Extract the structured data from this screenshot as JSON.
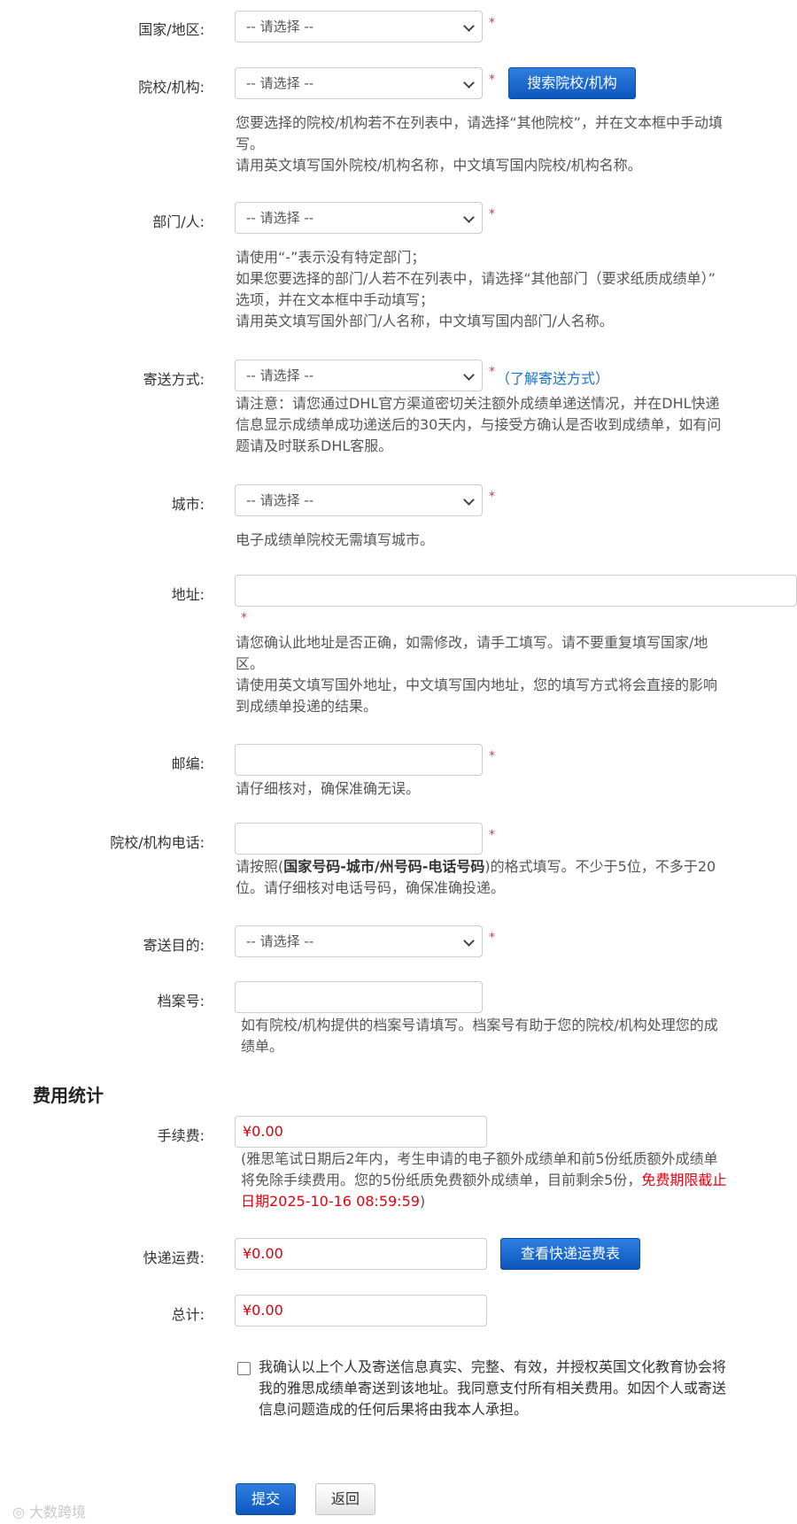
{
  "fields": {
    "country": {
      "label": "国家/地区:",
      "placeholder": "-- 请选择 --"
    },
    "institution": {
      "label": "院校/机构:",
      "placeholder": "-- 请选择 --",
      "search_button": "搜索院校/机构",
      "help": [
        "您要选择的院校/机构若不在列表中，请选择“其他院校”，并在文本框中手动填",
        "写。",
        "请用英文填写国外院校/机构名称，中文填写国内院校/机构名称。"
      ]
    },
    "department": {
      "label": "部门/人:",
      "placeholder": "-- 请选择 --",
      "help": [
        "请使用“-”表示没有特定部门；",
        "如果您要选择的部门/人若不在列表中，请选择“其他部门（要求纸质成绩单）”",
        "选项，并在文本框中手动填写；",
        "请用英文填写国外部门/人名称，中文填写国内部门/人名称。"
      ]
    },
    "delivery": {
      "label": "寄送方式:",
      "placeholder": "-- 请选择 --",
      "learn_link": "（了解寄送方式）",
      "help": [
        "请注意：请您通过DHL官方渠道密切关注额外成绩单递送情况，并在DHL快递",
        "信息显示成绩单成功递送后的30天内，与接受方确认是否收到成绩单，如有问",
        "题请及时联系DHL客服。"
      ]
    },
    "city": {
      "label": "城市:",
      "placeholder": "-- 请选择 --",
      "help": "电子成绩单院校无需填写城市。"
    },
    "address": {
      "label": "地址:",
      "value": "",
      "help": [
        "请您确认此地址是否正确，如需修改，请手工填写。请不要重复填写国家/地",
        "区。",
        "请使用英文填写国外地址，中文填写国内地址，您的填写方式将会直接的影响",
        "到成绩单投递的结果。"
      ]
    },
    "postcode": {
      "label": "邮编:",
      "value": "",
      "help": "请仔细核对，确保准确无误。"
    },
    "phone": {
      "label": "院校/机构电话:",
      "value": "",
      "help_pre": "请按照(",
      "help_bold": "国家号码-城市/州号码-电话号码",
      "help_post": ")的格式填写。不少于5位，不多于20",
      "help_line2": "位。请仔细核对电话号码，确保准确投递。"
    },
    "purpose": {
      "label": "寄送目的:",
      "placeholder": "-- 请选择 --"
    },
    "file_no": {
      "label": "档案号:",
      "value": "",
      "help": [
        "如有院校/机构提供的档案号请填写。档案号有助于您的院校/机构处理您的成",
        "绩单。"
      ]
    }
  },
  "required_mark": "*",
  "fees": {
    "title": "费用统计",
    "handling": {
      "label": "手续费:",
      "value": "¥0.00",
      "help_line1": "(雅思笔试日期后2年内，考生申请的电子额外成绩单和前5份纸质额外成绩单",
      "help_line2_pre": "将免除手续费用。您的5份纸质免费额外成绩单，目前剩余5份，",
      "help_line2_red": "免费期限截止",
      "help_line3_red": "日期2025-10-16 08:59:59",
      "help_line3_post": ")"
    },
    "express": {
      "label": "快递运费:",
      "value": "¥0.00",
      "button": "查看快递运费表"
    },
    "total": {
      "label": "总计:",
      "value": "¥0.00"
    }
  },
  "confirm": {
    "text": [
      "我确认以上个人及寄送信息真实、完整、有效，并授权英国文化教育协会将",
      "我的雅思成绩单寄送到该地址。我同意支付所有相关费用。如因个人或寄送",
      "信息问题造成的任何后果将由我本人承担。"
    ],
    "checked": false
  },
  "actions": {
    "submit": "提交",
    "back": "返回"
  },
  "watermark": "大数跨境"
}
